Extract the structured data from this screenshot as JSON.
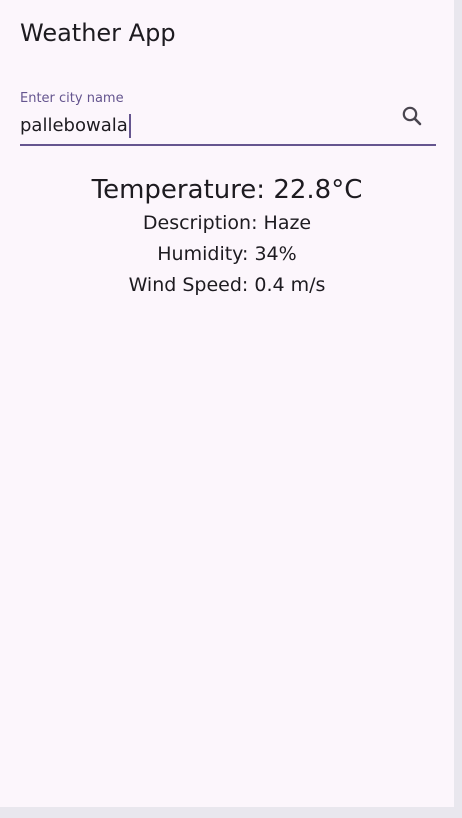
{
  "appbar": {
    "title": "Weather App"
  },
  "search": {
    "label": "Enter city name",
    "value": "pallebowala",
    "icon": "search-icon"
  },
  "weather": {
    "temperature": "Temperature: 22.8°C",
    "description": "Description: Haze",
    "humidity": "Humidity: 34%",
    "wind_speed": "Wind Speed: 0.4 m/s"
  },
  "colors": {
    "background": "#fcf6fc",
    "accent": "#65558f",
    "text": "#1d1b20"
  }
}
